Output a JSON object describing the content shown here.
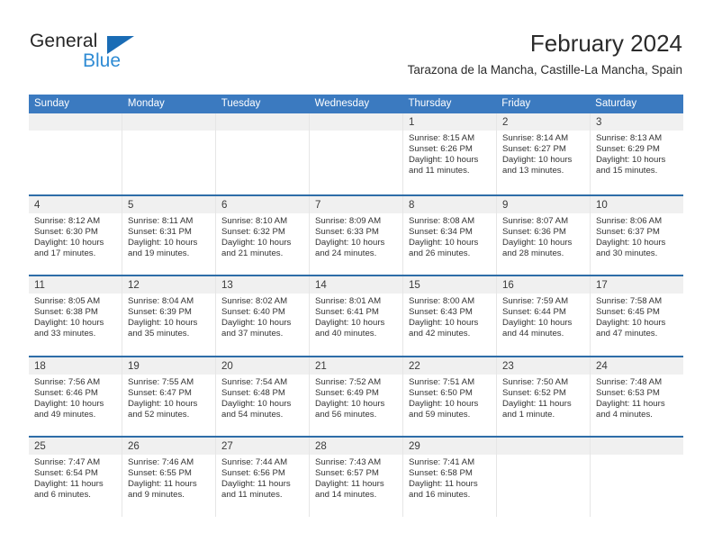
{
  "brand": {
    "name_part1": "General",
    "name_part2": "Blue",
    "accent_color": "#2e8bd4",
    "triangle_color": "#1a6cb5"
  },
  "header": {
    "title": "February 2024",
    "subtitle": "Tarazona de la Mancha, Castille-La Mancha, Spain"
  },
  "theme": {
    "header_bar_color": "#3b7ac0",
    "row_divider_color": "#2e6da8",
    "daynum_band_color": "#f0f0f0"
  },
  "weekdays": [
    "Sunday",
    "Monday",
    "Tuesday",
    "Wednesday",
    "Thursday",
    "Friday",
    "Saturday"
  ],
  "weeks": [
    [
      {
        "empty": true
      },
      {
        "empty": true
      },
      {
        "empty": true
      },
      {
        "empty": true
      },
      {
        "day": "1",
        "sunrise": "Sunrise: 8:15 AM",
        "sunset": "Sunset: 6:26 PM",
        "daylight": "Daylight: 10 hours and 11 minutes."
      },
      {
        "day": "2",
        "sunrise": "Sunrise: 8:14 AM",
        "sunset": "Sunset: 6:27 PM",
        "daylight": "Daylight: 10 hours and 13 minutes."
      },
      {
        "day": "3",
        "sunrise": "Sunrise: 8:13 AM",
        "sunset": "Sunset: 6:29 PM",
        "daylight": "Daylight: 10 hours and 15 minutes."
      }
    ],
    [
      {
        "day": "4",
        "sunrise": "Sunrise: 8:12 AM",
        "sunset": "Sunset: 6:30 PM",
        "daylight": "Daylight: 10 hours and 17 minutes."
      },
      {
        "day": "5",
        "sunrise": "Sunrise: 8:11 AM",
        "sunset": "Sunset: 6:31 PM",
        "daylight": "Daylight: 10 hours and 19 minutes."
      },
      {
        "day": "6",
        "sunrise": "Sunrise: 8:10 AM",
        "sunset": "Sunset: 6:32 PM",
        "daylight": "Daylight: 10 hours and 21 minutes."
      },
      {
        "day": "7",
        "sunrise": "Sunrise: 8:09 AM",
        "sunset": "Sunset: 6:33 PM",
        "daylight": "Daylight: 10 hours and 24 minutes."
      },
      {
        "day": "8",
        "sunrise": "Sunrise: 8:08 AM",
        "sunset": "Sunset: 6:34 PM",
        "daylight": "Daylight: 10 hours and 26 minutes."
      },
      {
        "day": "9",
        "sunrise": "Sunrise: 8:07 AM",
        "sunset": "Sunset: 6:36 PM",
        "daylight": "Daylight: 10 hours and 28 minutes."
      },
      {
        "day": "10",
        "sunrise": "Sunrise: 8:06 AM",
        "sunset": "Sunset: 6:37 PM",
        "daylight": "Daylight: 10 hours and 30 minutes."
      }
    ],
    [
      {
        "day": "11",
        "sunrise": "Sunrise: 8:05 AM",
        "sunset": "Sunset: 6:38 PM",
        "daylight": "Daylight: 10 hours and 33 minutes."
      },
      {
        "day": "12",
        "sunrise": "Sunrise: 8:04 AM",
        "sunset": "Sunset: 6:39 PM",
        "daylight": "Daylight: 10 hours and 35 minutes."
      },
      {
        "day": "13",
        "sunrise": "Sunrise: 8:02 AM",
        "sunset": "Sunset: 6:40 PM",
        "daylight": "Daylight: 10 hours and 37 minutes."
      },
      {
        "day": "14",
        "sunrise": "Sunrise: 8:01 AM",
        "sunset": "Sunset: 6:41 PM",
        "daylight": "Daylight: 10 hours and 40 minutes."
      },
      {
        "day": "15",
        "sunrise": "Sunrise: 8:00 AM",
        "sunset": "Sunset: 6:43 PM",
        "daylight": "Daylight: 10 hours and 42 minutes."
      },
      {
        "day": "16",
        "sunrise": "Sunrise: 7:59 AM",
        "sunset": "Sunset: 6:44 PM",
        "daylight": "Daylight: 10 hours and 44 minutes."
      },
      {
        "day": "17",
        "sunrise": "Sunrise: 7:58 AM",
        "sunset": "Sunset: 6:45 PM",
        "daylight": "Daylight: 10 hours and 47 minutes."
      }
    ],
    [
      {
        "day": "18",
        "sunrise": "Sunrise: 7:56 AM",
        "sunset": "Sunset: 6:46 PM",
        "daylight": "Daylight: 10 hours and 49 minutes."
      },
      {
        "day": "19",
        "sunrise": "Sunrise: 7:55 AM",
        "sunset": "Sunset: 6:47 PM",
        "daylight": "Daylight: 10 hours and 52 minutes."
      },
      {
        "day": "20",
        "sunrise": "Sunrise: 7:54 AM",
        "sunset": "Sunset: 6:48 PM",
        "daylight": "Daylight: 10 hours and 54 minutes."
      },
      {
        "day": "21",
        "sunrise": "Sunrise: 7:52 AM",
        "sunset": "Sunset: 6:49 PM",
        "daylight": "Daylight: 10 hours and 56 minutes."
      },
      {
        "day": "22",
        "sunrise": "Sunrise: 7:51 AM",
        "sunset": "Sunset: 6:50 PM",
        "daylight": "Daylight: 10 hours and 59 minutes."
      },
      {
        "day": "23",
        "sunrise": "Sunrise: 7:50 AM",
        "sunset": "Sunset: 6:52 PM",
        "daylight": "Daylight: 11 hours and 1 minute."
      },
      {
        "day": "24",
        "sunrise": "Sunrise: 7:48 AM",
        "sunset": "Sunset: 6:53 PM",
        "daylight": "Daylight: 11 hours and 4 minutes."
      }
    ],
    [
      {
        "day": "25",
        "sunrise": "Sunrise: 7:47 AM",
        "sunset": "Sunset: 6:54 PM",
        "daylight": "Daylight: 11 hours and 6 minutes."
      },
      {
        "day": "26",
        "sunrise": "Sunrise: 7:46 AM",
        "sunset": "Sunset: 6:55 PM",
        "daylight": "Daylight: 11 hours and 9 minutes."
      },
      {
        "day": "27",
        "sunrise": "Sunrise: 7:44 AM",
        "sunset": "Sunset: 6:56 PM",
        "daylight": "Daylight: 11 hours and 11 minutes."
      },
      {
        "day": "28",
        "sunrise": "Sunrise: 7:43 AM",
        "sunset": "Sunset: 6:57 PM",
        "daylight": "Daylight: 11 hours and 14 minutes."
      },
      {
        "day": "29",
        "sunrise": "Sunrise: 7:41 AM",
        "sunset": "Sunset: 6:58 PM",
        "daylight": "Daylight: 11 hours and 16 minutes."
      },
      {
        "empty": true
      },
      {
        "empty": true
      }
    ]
  ]
}
